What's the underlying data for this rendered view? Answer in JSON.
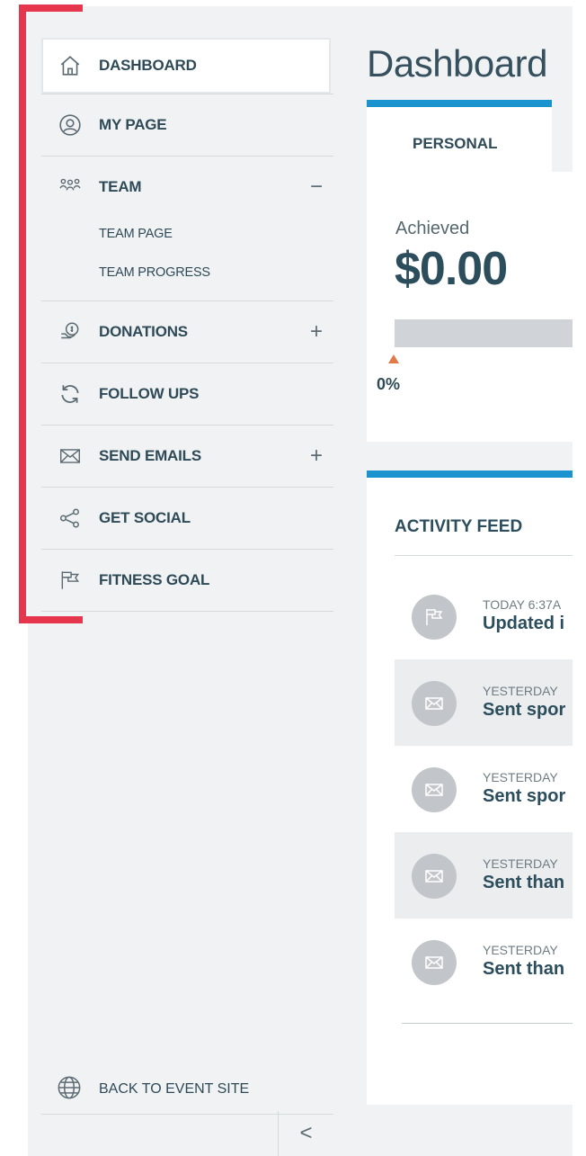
{
  "sidebar": {
    "items": [
      {
        "label": "DASHBOARD",
        "icon": "home-icon",
        "control": ""
      },
      {
        "label": "MY PAGE",
        "icon": "user-circle-icon",
        "control": ""
      },
      {
        "label": "TEAM",
        "icon": "team-icon",
        "control": "−"
      },
      {
        "label": "DONATIONS",
        "icon": "donation-icon",
        "control": "+"
      },
      {
        "label": "FOLLOW UPS",
        "icon": "refresh-icon",
        "control": ""
      },
      {
        "label": "SEND EMAILS",
        "icon": "envelope-icon",
        "control": "+"
      },
      {
        "label": "GET SOCIAL",
        "icon": "share-icon",
        "control": ""
      },
      {
        "label": "FITNESS GOAL",
        "icon": "flag-icon",
        "control": ""
      }
    ],
    "team_subitems": [
      "TEAM PAGE",
      "TEAM PROGRESS"
    ],
    "back_to_site": "BACK TO EVENT SITE",
    "collapse": "<"
  },
  "main": {
    "title": "Dashboard",
    "tabs": [
      {
        "label": "PERSONAL",
        "active": true
      }
    ],
    "achieved": {
      "label": "Achieved",
      "amount": "$0.00",
      "progress_percent_text": "0%",
      "progress_value": 0
    },
    "activity_feed": {
      "title": "ACTIVITY FEED",
      "items": [
        {
          "timestamp": "TODAY 6:37A",
          "text": "Updated i",
          "icon": "flag-icon"
        },
        {
          "timestamp": "YESTERDAY",
          "text": "Sent spor",
          "icon": "envelope-icon"
        },
        {
          "timestamp": "YESTERDAY",
          "text": "Sent spor",
          "icon": "envelope-icon"
        },
        {
          "timestamp": "YESTERDAY",
          "text": "Sent than",
          "icon": "envelope-icon"
        },
        {
          "timestamp": "YESTERDAY",
          "text": "Sent than",
          "icon": "envelope-icon"
        }
      ]
    }
  },
  "colors": {
    "accent": "#1a93cf",
    "highlight": "#e5364d",
    "progress": "#e07a48",
    "text": "#2f4a57"
  }
}
